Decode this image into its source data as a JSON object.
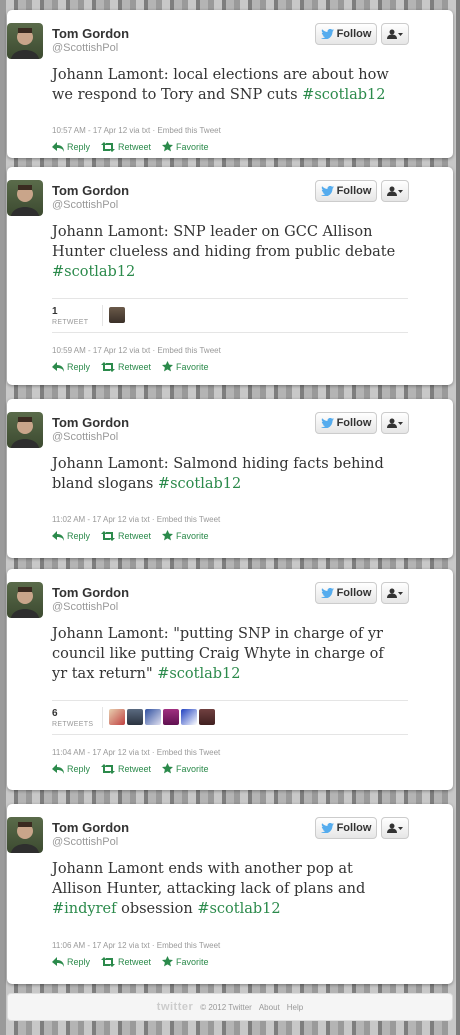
{
  "colors": {
    "accent": "#2b8a4b",
    "follow_bird": "#55acee"
  },
  "icons": {
    "follow": "twitter-bird-icon",
    "user_menu": "user-dropdown-icon",
    "reply": "reply-arrow-icon",
    "retweet": "retweet-icon",
    "favorite": "star-icon"
  },
  "tweets": [
    {
      "name": "Tom Gordon",
      "handle": "@ScottishPol",
      "follow_label": "Follow",
      "text": "Johann Lamont: local elections are about how we respond to Tory and SNP cuts ",
      "hashtag": "#scotlab12",
      "meta": "10:57 AM - 17 Apr 12 via txt · Embed this Tweet",
      "reply": "Reply",
      "retweet": "Retweet",
      "favorite": "Favorite"
    },
    {
      "name": "Tom Gordon",
      "handle": "@ScottishPol",
      "follow_label": "Follow",
      "text": "Johann Lamont: SNP leader on GCC Allison Hunter clueless and hiding from public debate ",
      "hashtag": "#scotlab12",
      "retweet_count": "1",
      "retweet_count_label": "RETWEET",
      "meta": "10:59 AM - 17 Apr 12 via txt · Embed this Tweet",
      "reply": "Reply",
      "retweet": "Retweet",
      "favorite": "Favorite"
    },
    {
      "name": "Tom Gordon",
      "handle": "@ScottishPol",
      "follow_label": "Follow",
      "text": "Johann Lamont: Salmond hiding facts behind bland slogans ",
      "hashtag": "#scotlab12",
      "meta": "11:02 AM - 17 Apr 12 via txt · Embed this Tweet",
      "reply": "Reply",
      "retweet": "Retweet",
      "favorite": "Favorite"
    },
    {
      "name": "Tom Gordon",
      "handle": "@ScottishPol",
      "follow_label": "Follow",
      "text": "Johann Lamont: \"putting SNP in charge of yr council like putting Craig Whyte in charge of yr tax return\" ",
      "hashtag": "#scotlab12",
      "retweet_count": "6",
      "retweet_count_label": "RETWEETS",
      "meta": "11:04 AM - 17 Apr 12 via txt · Embed this Tweet",
      "reply": "Reply",
      "retweet": "Retweet",
      "favorite": "Favorite"
    },
    {
      "name": "Tom Gordon",
      "handle": "@ScottishPol",
      "follow_label": "Follow",
      "text_before": "Johann Lamont ends with another pop at Allison Hunter, attacking lack of plans and ",
      "hashtag_mid": "#indyref",
      "text_after": " obsession ",
      "hashtag": "#scotlab12",
      "meta": "11:06 AM - 17 Apr 12 via txt · Embed this Tweet",
      "reply": "Reply",
      "retweet": "Retweet",
      "favorite": "Favorite"
    }
  ],
  "footer": {
    "brand": "twitter",
    "copyright": "© 2012 Twitter",
    "about": "About",
    "help": "Help"
  }
}
